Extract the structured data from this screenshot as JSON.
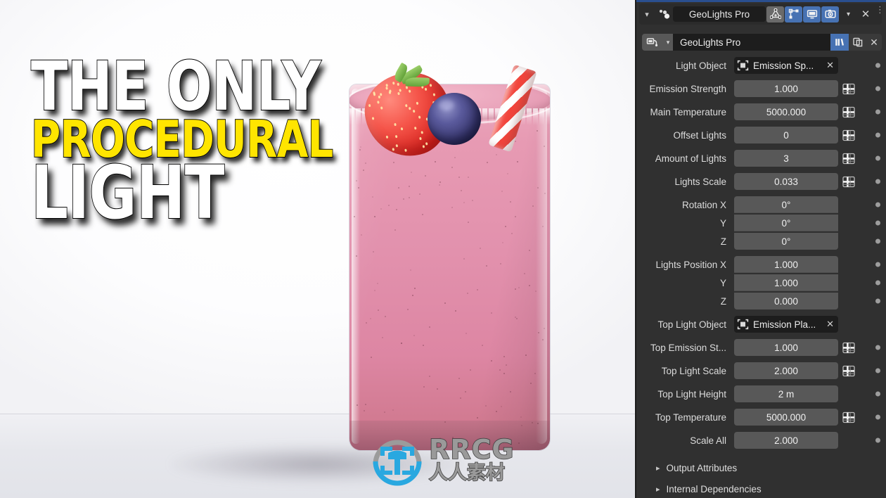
{
  "poster": {
    "title_lines": [
      {
        "text": "THE ONLY",
        "color": "#ffffff"
      },
      {
        "text": "PROCEDURAL",
        "color": "#ffe500"
      },
      {
        "text": "LIGHT",
        "color": "#ffffff"
      }
    ],
    "subject": "pink berry smoothie in a glass with strawberry, blueberry and striped straw"
  },
  "watermark": {
    "brand": "RRCG",
    "brand_cn": "人人素材",
    "logo_color": "#29a8e0",
    "text_color": "#9a9a9a"
  },
  "panel": {
    "modifier_header": {
      "expand_icon": "chevron-down-icon",
      "type_icon": "geometry-nodes-icon",
      "name": "GeoLights Pro",
      "toggles": [
        {
          "name": "edit-mode-display-toggle",
          "icon": "vertex-group-icon",
          "active": false
        },
        {
          "name": "edit-mode-toggle",
          "icon": "edit-mode-icon",
          "active": true
        },
        {
          "name": "realtime-display-toggle",
          "icon": "monitor-icon",
          "active": true
        },
        {
          "name": "render-display-toggle",
          "icon": "camera-icon",
          "active": true
        }
      ],
      "dropdown_icon": "chevron-down-icon",
      "close_icon": "close-icon",
      "kebab_icon": "grip-dots-icon"
    },
    "datablock": {
      "browse_icon": "node-group-icon",
      "browse_chevron": "chevron-down-icon",
      "name": "GeoLights Pro",
      "fake_user_icon": "fake-user-shield-icon",
      "duplicate_icon": "duplicate-icon",
      "unlink_icon": "close-icon"
    },
    "properties": [
      {
        "label": "Light Object",
        "value": "Emission Sp...",
        "kind": "object",
        "object_icon": "object-data-icon",
        "clear_icon": "close-icon",
        "attr_toggle": false,
        "decorator": true,
        "group": "single"
      },
      {
        "label": "Emission Strength",
        "value": "1.000",
        "kind": "value",
        "attr_toggle": true,
        "decorator": true,
        "group": "single"
      },
      {
        "label": "Main Temperature",
        "value": "5000.000",
        "kind": "value",
        "attr_toggle": true,
        "decorator": true,
        "group": "single"
      },
      {
        "label": "Offset Lights",
        "value": "0",
        "kind": "value",
        "attr_toggle": true,
        "decorator": true,
        "group": "single"
      },
      {
        "label": "Amount of Lights",
        "value": "3",
        "kind": "value",
        "attr_toggle": true,
        "decorator": true,
        "group": "single"
      },
      {
        "label": "Lights Scale",
        "value": "0.033",
        "kind": "value",
        "attr_toggle": true,
        "decorator": true,
        "group": "single"
      },
      {
        "label": "Rotation X",
        "value": "0°",
        "kind": "value",
        "attr_toggle": false,
        "decorator": true,
        "group": "top"
      },
      {
        "label": "Y",
        "value": "0°",
        "kind": "value",
        "attr_toggle": false,
        "decorator": true,
        "group": "mid"
      },
      {
        "label": "Z",
        "value": "0°",
        "kind": "value",
        "attr_toggle": false,
        "decorator": true,
        "group": "bot"
      },
      {
        "label": "Lights Position X",
        "value": "1.000",
        "kind": "value",
        "attr_toggle": false,
        "decorator": true,
        "group": "top"
      },
      {
        "label": "Y",
        "value": "1.000",
        "kind": "value",
        "attr_toggle": false,
        "decorator": true,
        "group": "mid"
      },
      {
        "label": "Z",
        "value": "0.000",
        "kind": "value",
        "attr_toggle": false,
        "decorator": true,
        "group": "bot"
      },
      {
        "label": "Top Light Object",
        "value": "Emission Pla...",
        "kind": "object",
        "object_icon": "object-data-icon",
        "clear_icon": "close-icon",
        "attr_toggle": false,
        "decorator": false,
        "group": "single"
      },
      {
        "label": "Top Emission St...",
        "value": "1.000",
        "kind": "value",
        "attr_toggle": true,
        "decorator": true,
        "group": "single"
      },
      {
        "label": "Top Light Scale",
        "value": "2.000",
        "kind": "value",
        "attr_toggle": true,
        "decorator": true,
        "group": "single"
      },
      {
        "label": "Top Light Height",
        "value": "2 m",
        "kind": "value",
        "attr_toggle": false,
        "decorator": true,
        "group": "single"
      },
      {
        "label": "Top Temperature",
        "value": "5000.000",
        "kind": "value",
        "attr_toggle": true,
        "decorator": true,
        "group": "single"
      },
      {
        "label": "Scale All",
        "value": "2.000",
        "kind": "value",
        "attr_toggle": false,
        "decorator": true,
        "group": "single"
      }
    ],
    "collapsed_sections": [
      {
        "label": "Output Attributes",
        "chevron": "chevron-right-icon"
      },
      {
        "label": "Internal Dependencies",
        "chevron": "chevron-right-icon"
      }
    ],
    "colors": {
      "background": "#303030",
      "field": "#585858",
      "field_dark": "#1d1d1d",
      "accent_blue": "#4772b3",
      "text": "#dcdcdc"
    }
  }
}
